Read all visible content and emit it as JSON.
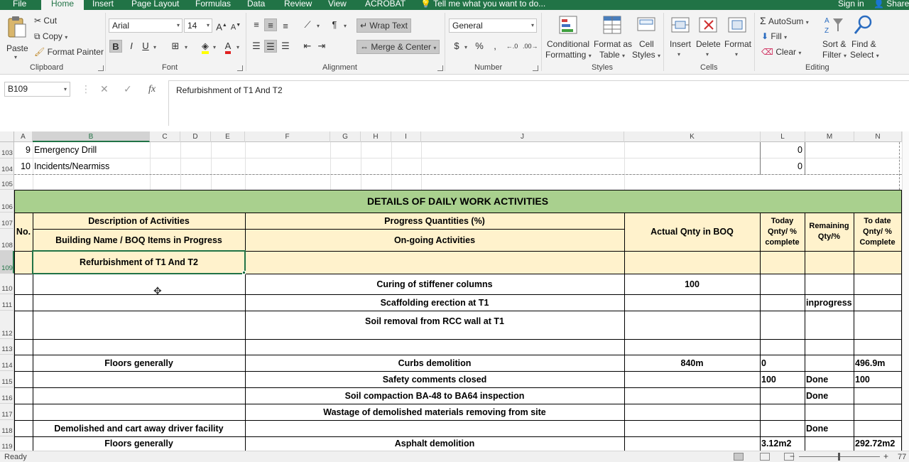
{
  "ribbon_tabs": {
    "file": "File",
    "home": "Home",
    "insert": "Insert",
    "page_layout": "Page Layout",
    "formulas": "Formulas",
    "data": "Data",
    "review": "Review",
    "view": "View",
    "acrobat": "ACROBAT",
    "tell_me": "Tell me what you want to do...",
    "sign_in": "Sign in",
    "share": "Share"
  },
  "clipboard": {
    "paste": "Paste",
    "cut": "Cut",
    "copy": "Copy",
    "format_painter": "Format Painter",
    "label": "Clipboard"
  },
  "font": {
    "name": "Arial",
    "size": "14",
    "bold": "B",
    "italic": "I",
    "underline": "U",
    "label": "Font"
  },
  "alignment": {
    "wrap_text": "Wrap Text",
    "merge_center": "Merge & Center",
    "label": "Alignment"
  },
  "number": {
    "format": "General",
    "currency": "$",
    "percent": "%",
    "comma": ",",
    "label": "Number"
  },
  "styles": {
    "conditional": "Conditional",
    "conditional2": "Formatting",
    "format_as": "Format as",
    "format_as2": "Table",
    "cell": "Cell",
    "cell2": "Styles",
    "label": "Styles"
  },
  "cells": {
    "insert": "Insert",
    "delete": "Delete",
    "format": "Format",
    "label": "Cells"
  },
  "editing": {
    "autosum": "AutoSum",
    "fill": "Fill",
    "clear": "Clear",
    "sort": "Sort &",
    "sort2": "Filter",
    "find": "Find &",
    "find2": "Select",
    "label": "Editing"
  },
  "formula_bar": {
    "name_box": "B109",
    "cancel": "✕",
    "enter": "✓",
    "fx": "fx",
    "content": "Refurbishment of T1 And T2"
  },
  "columns": [
    "A",
    "B",
    "C",
    "D",
    "E",
    "F",
    "G",
    "H",
    "I",
    "J",
    "K",
    "L",
    "M",
    "N"
  ],
  "rows": [
    "103",
    "104",
    "105",
    "106",
    "107",
    "108",
    "109",
    "110",
    "111",
    "112",
    "113",
    "114",
    "115",
    "116",
    "117",
    "118",
    "119"
  ],
  "sheet": {
    "r103_no": "9",
    "r103_desc": "Emergency Drill",
    "r103_l": "0",
    "r104_no": "10",
    "r104_desc": "Incidents/Nearmiss",
    "r104_l": "0",
    "title": "DETAILS OF DAILY WORK ACTIVITIES",
    "hdr_no": "No.",
    "hdr_desc": "Description of Activities",
    "hdr_building": "Building Name / BOQ Items in Progress",
    "hdr_progress": "Progress Quantities (%)",
    "hdr_ongoing": "On-going Activities",
    "hdr_actual": "Actual Qnty in BOQ",
    "hdr_today_1": "Today",
    "hdr_today_2": "Qnty/ %",
    "hdr_today_3": "complete",
    "hdr_remaining_1": "Remaining",
    "hdr_remaining_2": "Qty/%",
    "hdr_todate_1": "To date",
    "hdr_todate_2": "Qnty/ %",
    "hdr_todate_3": "Complete",
    "r109_b": "Refurbishment of T1 And T2",
    "r110_f": "Curing of stiffener columns",
    "r110_k": "100",
    "r111_f": "Scaffolding erection at T1",
    "r111_m": "inprogress",
    "r112_f": "Soil removal from RCC wall at T1",
    "r114_b": "Floors generally",
    "r114_f": "Curbs demolition",
    "r114_k": "840m",
    "r114_l": "0",
    "r114_n": "496.9m",
    "r115_f": "Safety comments closed",
    "r115_l": "100",
    "r115_m": "Done",
    "r115_n": "100",
    "r116_f": "Soil compaction BA-48 to BA64 inspection",
    "r116_m": "Done",
    "r117_f": "Wastage of  demolished materials removing from site",
    "r118_b": "Demolished and cart away driver facility",
    "r118_m": "Done",
    "r119_b": "Floors generally",
    "r119_f": "Asphalt demolition",
    "r119_l": "3.12m2",
    "r119_n": "292.72m2"
  },
  "status": {
    "ready": "Ready",
    "zoom": "77"
  },
  "colors": {
    "excel_green": "#217346",
    "title_fill": "#a9d08e",
    "header_fill": "#fff2cc"
  }
}
